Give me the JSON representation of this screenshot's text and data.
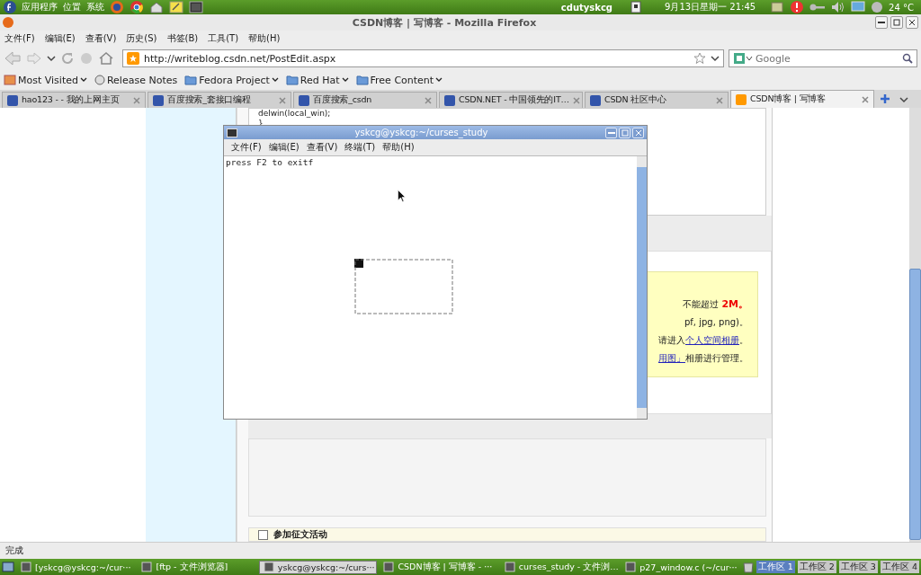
{
  "top_panel": {
    "menus": [
      "应用程序",
      "位置",
      "系统"
    ],
    "user": "cdutyskcg",
    "clock": "9月13日星期一 21:45",
    "weather": "24 °C"
  },
  "window": {
    "title": "CSDN博客 | 写博客 - Mozilla Firefox"
  },
  "menubar": [
    "文件(F)",
    "编辑(E)",
    "查看(V)",
    "历史(S)",
    "书签(B)",
    "工具(T)",
    "帮助(H)"
  ],
  "toolbar": {
    "url": "http://writeblog.csdn.net/PostEdit.aspx",
    "search_placeholder": "Google"
  },
  "bookmarks": [
    {
      "label": "Most Visited",
      "kind": "menu"
    },
    {
      "label": "Release Notes",
      "kind": "link"
    },
    {
      "label": "Fedora Project",
      "kind": "folder"
    },
    {
      "label": "Red Hat",
      "kind": "folder"
    },
    {
      "label": "Free Content",
      "kind": "folder"
    }
  ],
  "tabs": [
    {
      "label": "hao123 - - 我的上网主页",
      "selected": false
    },
    {
      "label": "百度搜索_套接口编程",
      "selected": false
    },
    {
      "label": "百度搜索_csdn",
      "selected": false
    },
    {
      "label": "CSDN.NET - 中国领先的IT…",
      "selected": false
    },
    {
      "label": "CSDN 社区中心",
      "selected": false
    },
    {
      "label": "CSDN博客 | 写博客",
      "selected": true
    }
  ],
  "page": {
    "code_lines": [
      "delwin(local_win);",
      "}"
    ],
    "notice_lines": [
      {
        "text": "不能超过 **2M。**"
      },
      {
        "text": "pf, jpg, png)。"
      },
      {
        "text": "请进入",
        "link": "个人空间相册",
        "after": "。"
      },
      {
        "link": "用图」",
        "after": "相册进行管理。"
      }
    ],
    "contest_checkbox": {
      "label": "参加征文活动",
      "checked": false
    }
  },
  "terminal": {
    "title": "yskcg@yskcg:~/curses_study",
    "menus": [
      "文件(F)",
      "编辑(E)",
      "查看(V)",
      "终端(T)",
      "帮助(H)"
    ],
    "output": "press F2 to exitf"
  },
  "status_bar": "完成",
  "taskbar": {
    "items": [
      {
        "label": "[yskcg@yskcg:~/cur···",
        "selected": false
      },
      {
        "label": "[ftp - 文件浏览器]",
        "selected": false
      },
      {
        "label": "yskcg@yskcg:~/curs···",
        "selected": true
      },
      {
        "label": "CSDN博客 | 写博客 - ···",
        "selected": false
      },
      {
        "label": "curses_study - 文件浏…",
        "selected": false
      },
      {
        "label": "p27_window.c (~/cur···",
        "selected": false
      }
    ],
    "workspaces": [
      {
        "label": "工作区 1",
        "selected": true
      },
      {
        "label": "工作区 2",
        "selected": false
      },
      {
        "label": "工作区 3",
        "selected": false
      },
      {
        "label": "工作区 4",
        "selected": false
      }
    ]
  }
}
